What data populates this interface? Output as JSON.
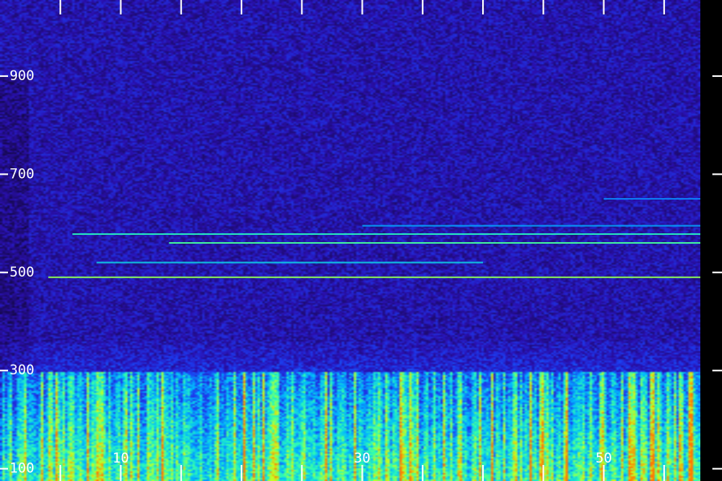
{
  "chart_data": {
    "type": "heatmap",
    "title": "",
    "xlabel": "",
    "ylabel": "",
    "y_axis": {
      "ylim": [
        100,
        1000
      ],
      "tick_labels": [
        "100",
        "300",
        "500",
        "700",
        "900"
      ],
      "tick_values": [
        100,
        300,
        500,
        700,
        900
      ]
    },
    "x_axis": {
      "xlim": [
        0,
        58
      ],
      "tick_labels": [
        "10",
        "30",
        "50"
      ],
      "tick_values": [
        10,
        30,
        50
      ],
      "minor_ticks": [
        5,
        10,
        15,
        20,
        25,
        30,
        35,
        40,
        45,
        50,
        55
      ]
    },
    "colormap": [
      "#000000",
      "#1a0a60",
      "#2a10b0",
      "#1c3cf0",
      "#00b8ff",
      "#30ffb0",
      "#c8ff20",
      "#ff7a00"
    ],
    "horizontal_lines": [
      {
        "y": 490,
        "x_start": 4,
        "x_end": 58,
        "intensity": 0.72
      },
      {
        "y": 520,
        "x_start": 8,
        "x_end": 40,
        "intensity": 0.45
      },
      {
        "y": 560,
        "x_start": 14,
        "x_end": 58,
        "intensity": 0.62
      },
      {
        "y": 578,
        "x_start": 6,
        "x_end": 58,
        "intensity": 0.55
      },
      {
        "y": 595,
        "x_start": 30,
        "x_end": 58,
        "intensity": 0.35
      },
      {
        "y": 650,
        "x_start": 50,
        "x_end": 58,
        "intensity": 0.3
      }
    ],
    "grid": false
  }
}
